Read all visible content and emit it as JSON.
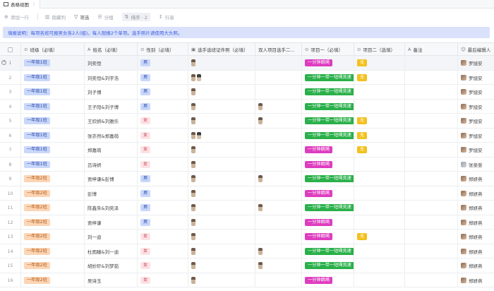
{
  "tab": {
    "title": "表格视图",
    "more": "⋮"
  },
  "toolbar": {
    "add": "添加一行",
    "hide": "隐藏列",
    "filter": "筛选",
    "group": "分组",
    "sort": "排序 · 2",
    "row_height": "行高"
  },
  "description": "填报说明：每项各班可报男女各2人(组)。每人限报2个单项。选手照片请使用大头照。",
  "columns": {
    "class": "班级（必填）",
    "name": "姓名（必填）",
    "gender": "性别（必填）",
    "photo": "选手选班证件照（必填）",
    "double_photo": "双人项目选手二...",
    "item1": "项目一（必填）",
    "item2": "项目二（选填）",
    "remark": "备注",
    "last_editor": "最后编辑人"
  },
  "rows": [
    {
      "no": "1",
      "class": "一年级1班",
      "class_type": "cls1",
      "name": "刘奕恒",
      "gender": "男",
      "gender_type": "male",
      "photo": 1,
      "double": 0,
      "item1": "一分钟跳绳",
      "item1_type": "pink",
      "item2": "无",
      "editor": "罗旭安",
      "highlight": true
    },
    {
      "no": "2",
      "class": "一年级1班",
      "class_type": "cls1",
      "name": "刘奕恒&刘宇浩",
      "gender": "男",
      "gender_type": "male",
      "photo": 2,
      "double": 0,
      "item1": "一分钟一带一短绳竞速",
      "item1_type": "green",
      "item2": "无",
      "editor": "罗旭安"
    },
    {
      "no": "3",
      "class": "一年级1班",
      "class_type": "cls1",
      "name": "刘子博",
      "gender": "男",
      "gender_type": "male",
      "photo": 1,
      "double": 0,
      "item1": "一分钟一带一短绳竞速",
      "item1_type": "green",
      "item2": "",
      "editor": "罗旭安"
    },
    {
      "no": "4",
      "class": "一年级1班",
      "class_type": "cls1",
      "name": "王子阳&刘子博",
      "gender": "男",
      "gender_type": "male",
      "photo": 1,
      "double": 1,
      "item1": "一分钟一带一短绳竞速",
      "item1_type": "green",
      "item2": "",
      "editor": "罗旭安"
    },
    {
      "no": "5",
      "class": "一年级1班",
      "class_type": "cls1",
      "name": "王欣妍&刘雅乐",
      "gender": "女",
      "gender_type": "female",
      "photo": 1,
      "double": 1,
      "item1": "一分钟一带一短绳竞速",
      "item1_type": "green",
      "item2": "无",
      "editor": "罗旭安"
    },
    {
      "no": "6",
      "class": "一年级1班",
      "class_type": "cls1",
      "name": "张亦然&郑嘉萌",
      "gender": "女",
      "gender_type": "female",
      "photo": 2,
      "double": 0,
      "item1": "一分钟一带一短绳竞速",
      "item1_type": "green",
      "item2": "无",
      "editor": "罗旭安"
    },
    {
      "no": "7",
      "class": "一年级1班",
      "class_type": "cls1",
      "name": "郑嘉萌",
      "gender": "女",
      "gender_type": "female",
      "photo": 1,
      "double": 0,
      "item1": "一分钟跳绳",
      "item1_type": "pink",
      "item2": "无",
      "editor": "罗旭安"
    },
    {
      "no": "8",
      "class": "一年级1班",
      "class_type": "cls1",
      "name": "吕诗妍",
      "gender": "女",
      "gender_type": "female",
      "photo": 1,
      "double": 0,
      "item1": "一分钟跳绳",
      "item1_type": "pink",
      "item2": "",
      "editor": "张斐斐",
      "editor_gray": true
    },
    {
      "no": "9",
      "class": "一年级2班",
      "class_type": "cls2",
      "name": "贾梓谦&彭博",
      "gender": "男",
      "gender_type": "male",
      "photo": 1,
      "double": 1,
      "item1": "一分钟一带一短绳竞速",
      "item1_type": "green",
      "item2": "",
      "editor": "郑妍燕"
    },
    {
      "no": "10",
      "class": "一年级2班",
      "class_type": "cls2",
      "name": "彭博",
      "gender": "男",
      "gender_type": "male",
      "photo": 1,
      "double": 0,
      "item1": "一分钟跳绳",
      "item1_type": "pink",
      "item2": "",
      "editor": "郑妍燕"
    },
    {
      "no": "11",
      "class": "一年级2班",
      "class_type": "cls2",
      "name": "陈鑫朱&刘奕泽",
      "gender": "男",
      "gender_type": "male",
      "photo": 1,
      "double": 1,
      "item1": "一分钟一带一短绳竞速",
      "item1_type": "green",
      "item2": "",
      "editor": "郑妍燕"
    },
    {
      "no": "12",
      "class": "一年级2班",
      "class_type": "cls2",
      "name": "贾梓谦",
      "gender": "男",
      "gender_type": "male",
      "photo": 1,
      "double": 0,
      "item1": "一分钟跳绳",
      "item1_type": "pink",
      "item2": "",
      "editor": "郑妍燕"
    },
    {
      "no": "13",
      "class": "一年级2班",
      "class_type": "cls2",
      "name": "刘一迪",
      "gender": "女",
      "gender_type": "female",
      "photo": 1,
      "double": 0,
      "item1": "一分钟跳绳",
      "item1_type": "pink",
      "item2": "无",
      "editor": "郑妍燕"
    },
    {
      "no": "14",
      "class": "一年级2班",
      "class_type": "cls2",
      "name": "杜雨瞳&刘一迪",
      "gender": "女",
      "gender_type": "female",
      "photo": 1,
      "double": 1,
      "item1": "一分钟一带一短绳竞速",
      "item1_type": "green",
      "item2": "",
      "editor": "郑妍燕"
    },
    {
      "no": "15",
      "class": "一年级2班",
      "class_type": "cls2",
      "name": "胡妙轩&刘梦茹",
      "gender": "女",
      "gender_type": "female",
      "photo": 1,
      "double": 1,
      "item1": "一分钟一带一短绳竞速",
      "item1_type": "green",
      "item2": "",
      "editor": "郑妍燕"
    },
    {
      "no": "16",
      "class": "一年级2班",
      "class_type": "cls2",
      "name": "吴诗玉",
      "gender": "女",
      "gender_type": "female",
      "photo": 1,
      "double": 0,
      "item1": "一分钟跳绳",
      "item1_type": "pink",
      "item2": "",
      "editor": "郑妍燕"
    }
  ]
}
